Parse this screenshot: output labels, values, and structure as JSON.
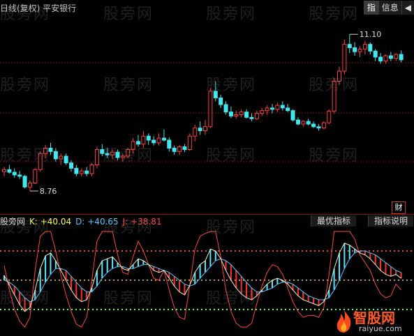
{
  "header": {
    "title": "日线(复权) 平安银行",
    "buttons": [
      {
        "label": "指"
      },
      {
        "label": "信息"
      },
      {
        "label": "◀"
      }
    ]
  },
  "price_chart": {
    "high_label": "11.10",
    "low_label": "8.76",
    "finance_tag": "财"
  },
  "indicator": {
    "name": "股旁网",
    "k_text": "K: +40.04",
    "d_text": "D: +40.65",
    "j_text": "J: +38.81",
    "k_color": "#ffff55",
    "d_color": "#55c8ff",
    "j_color": "#ff4444",
    "buttons": [
      "最优指标",
      "指标说明"
    ]
  },
  "watermark": "股旁网",
  "logo": {
    "brand": "智股网",
    "url": "raiyue.com"
  },
  "colors": {
    "up": "#ff4040",
    "down": "#40e8f0",
    "background": "#000000",
    "grid": "#7a1010"
  },
  "chart_data": {
    "type": "candlestick",
    "title": "平安银行",
    "ylabel": "",
    "y_range": [
      8.5,
      11.3
    ],
    "max_price": 11.1,
    "min_price": 8.76,
    "candles_ohlc": [
      [
        9.05,
        9.12,
        8.98,
        9.08
      ],
      [
        9.08,
        9.15,
        9.02,
        9.04
      ],
      [
        9.04,
        9.1,
        8.96,
        9.0
      ],
      [
        9.0,
        9.06,
        8.94,
        8.98
      ],
      [
        8.98,
        9.0,
        8.8,
        8.82
      ],
      [
        8.82,
        8.92,
        8.76,
        8.88
      ],
      [
        8.88,
        9.1,
        8.86,
        9.08
      ],
      [
        9.08,
        9.35,
        9.05,
        9.32
      ],
      [
        9.32,
        9.45,
        9.25,
        9.4
      ],
      [
        9.4,
        9.48,
        9.3,
        9.35
      ],
      [
        9.35,
        9.4,
        9.2,
        9.24
      ],
      [
        9.24,
        9.32,
        9.15,
        9.28
      ],
      [
        9.28,
        9.32,
        9.15,
        9.18
      ],
      [
        9.18,
        9.22,
        9.05,
        9.1
      ],
      [
        9.1,
        9.15,
        8.98,
        9.02
      ],
      [
        9.02,
        9.1,
        8.98,
        9.06
      ],
      [
        9.06,
        9.12,
        8.98,
        9.02
      ],
      [
        9.02,
        9.18,
        8.98,
        9.15
      ],
      [
        9.15,
        9.42,
        9.1,
        9.38
      ],
      [
        9.38,
        9.46,
        9.28,
        9.32
      ],
      [
        9.32,
        9.4,
        9.25,
        9.3
      ],
      [
        9.3,
        9.38,
        9.24,
        9.34
      ],
      [
        9.34,
        9.38,
        9.22,
        9.26
      ],
      [
        9.26,
        9.32,
        9.2,
        9.28
      ],
      [
        9.28,
        9.4,
        9.25,
        9.38
      ],
      [
        9.38,
        9.55,
        9.32,
        9.5
      ],
      [
        9.5,
        9.6,
        9.42,
        9.46
      ],
      [
        9.46,
        9.66,
        9.4,
        9.58
      ],
      [
        9.58,
        9.62,
        9.45,
        9.52
      ],
      [
        9.52,
        9.58,
        9.44,
        9.48
      ],
      [
        9.48,
        9.62,
        9.44,
        9.55
      ],
      [
        9.55,
        9.68,
        9.5,
        9.52
      ],
      [
        9.52,
        9.56,
        9.35,
        9.4
      ],
      [
        9.4,
        9.44,
        9.3,
        9.35
      ],
      [
        9.35,
        9.45,
        9.3,
        9.42
      ],
      [
        9.42,
        9.46,
        9.34,
        9.38
      ],
      [
        9.38,
        9.62,
        9.36,
        9.58
      ],
      [
        9.58,
        9.75,
        9.5,
        9.7
      ],
      [
        9.7,
        9.8,
        9.6,
        9.66
      ],
      [
        9.66,
        9.82,
        9.6,
        9.72
      ],
      [
        9.72,
        10.3,
        9.7,
        10.25
      ],
      [
        10.25,
        10.4,
        10.1,
        10.15
      ],
      [
        10.15,
        10.2,
        10.0,
        10.05
      ],
      [
        10.05,
        10.1,
        9.9,
        9.94
      ],
      [
        9.94,
        10.02,
        9.85,
        9.88
      ],
      [
        9.88,
        9.96,
        9.84,
        9.9
      ],
      [
        9.9,
        9.98,
        9.86,
        9.94
      ],
      [
        9.94,
        9.98,
        9.84,
        9.86
      ],
      [
        9.86,
        9.92,
        9.8,
        9.84
      ],
      [
        9.84,
        9.96,
        9.82,
        9.92
      ],
      [
        9.92,
        10.0,
        9.88,
        9.96
      ],
      [
        9.96,
        10.04,
        9.9,
        10.0
      ],
      [
        10.0,
        10.06,
        9.92,
        9.98
      ],
      [
        9.98,
        10.08,
        9.94,
        10.04
      ],
      [
        10.04,
        10.1,
        9.96,
        10.0
      ],
      [
        10.0,
        10.06,
        9.94,
        9.96
      ],
      [
        9.96,
        9.98,
        9.8,
        9.82
      ],
      [
        9.82,
        9.86,
        9.74,
        9.76
      ],
      [
        9.76,
        9.82,
        9.72,
        9.8
      ],
      [
        9.8,
        9.84,
        9.74,
        9.76
      ],
      [
        9.76,
        9.8,
        9.7,
        9.72
      ],
      [
        9.72,
        9.76,
        9.66,
        9.7
      ],
      [
        9.7,
        9.8,
        9.68,
        9.78
      ],
      [
        9.78,
        9.98,
        9.76,
        9.95
      ],
      [
        9.95,
        10.45,
        9.92,
        10.4
      ],
      [
        10.4,
        10.62,
        10.35,
        10.55
      ],
      [
        10.55,
        11.02,
        10.5,
        10.95
      ],
      [
        10.95,
        11.1,
        10.82,
        10.9
      ],
      [
        10.9,
        10.98,
        10.78,
        10.84
      ],
      [
        10.84,
        10.92,
        10.76,
        10.88
      ],
      [
        10.88,
        11.0,
        10.8,
        10.95
      ],
      [
        10.95,
        10.98,
        10.8,
        10.85
      ],
      [
        10.85,
        10.88,
        10.7,
        10.76
      ],
      [
        10.76,
        10.82,
        10.66,
        10.7
      ],
      [
        10.7,
        10.8,
        10.66,
        10.78
      ],
      [
        10.78,
        10.84,
        10.7,
        10.74
      ],
      [
        10.74,
        10.82,
        10.7,
        10.8
      ],
      [
        10.8,
        10.86,
        10.68,
        10.72
      ]
    ],
    "kdj": {
      "k": [
        55,
        45,
        35,
        25,
        18,
        22,
        40,
        62,
        75,
        78,
        70,
        60,
        50,
        40,
        32,
        28,
        30,
        42,
        60,
        70,
        72,
        74,
        68,
        62,
        60,
        66,
        72,
        70,
        66,
        60,
        58,
        60,
        52,
        44,
        38,
        35,
        45,
        58,
        66,
        70,
        82,
        80,
        72,
        60,
        50,
        42,
        36,
        32,
        30,
        34,
        40,
        46,
        50,
        52,
        50,
        46,
        40,
        34,
        30,
        28,
        26,
        24,
        28,
        40,
        62,
        78,
        88,
        86,
        82,
        78,
        76,
        72,
        66,
        60,
        56,
        54,
        56,
        52
      ],
      "d": [
        50,
        48,
        44,
        38,
        32,
        28,
        30,
        38,
        48,
        56,
        62,
        62,
        60,
        54,
        48,
        42,
        38,
        38,
        44,
        52,
        58,
        62,
        64,
        64,
        62,
        62,
        64,
        66,
        66,
        64,
        62,
        60,
        58,
        54,
        50,
        46,
        44,
        46,
        52,
        58,
        64,
        70,
        72,
        70,
        66,
        60,
        54,
        48,
        42,
        38,
        38,
        40,
        42,
        46,
        48,
        48,
        46,
        42,
        38,
        34,
        32,
        30,
        30,
        32,
        40,
        50,
        62,
        72,
        78,
        80,
        80,
        78,
        76,
        72,
        68,
        64,
        60,
        58
      ],
      "j": [
        65,
        40,
        20,
        8,
        2,
        12,
        60,
        95,
        100,
        100,
        80,
        55,
        35,
        18,
        5,
        2,
        12,
        50,
        90,
        100,
        100,
        100,
        76,
        58,
        56,
        74,
        90,
        80,
        66,
        52,
        50,
        60,
        40,
        22,
        12,
        10,
        45,
        82,
        95,
        98,
        100,
        100,
        74,
        40,
        18,
        6,
        2,
        2,
        6,
        26,
        44,
        58,
        66,
        64,
        56,
        42,
        28,
        18,
        12,
        14,
        14,
        12,
        22,
        55,
        100,
        100,
        100,
        100,
        92,
        76,
        68,
        60,
        46,
        36,
        32,
        34,
        46,
        40
      ]
    }
  }
}
